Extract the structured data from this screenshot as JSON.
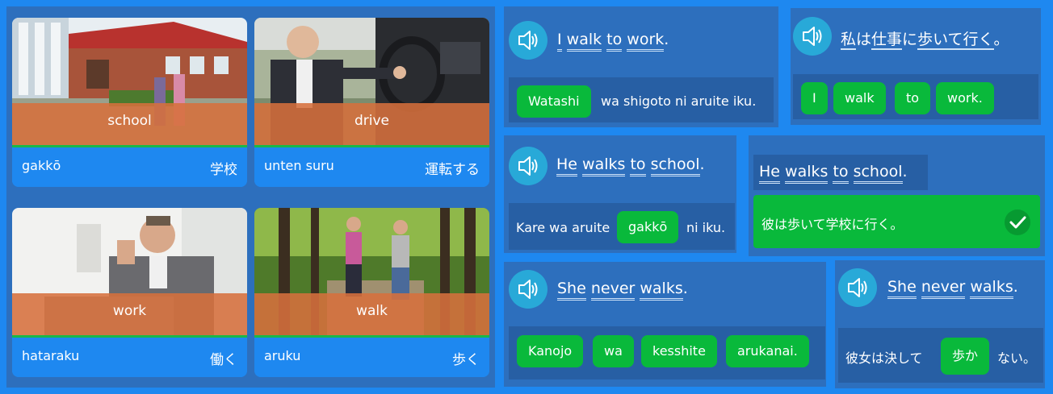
{
  "vocab": [
    {
      "en": "school",
      "romaji": "gakkō",
      "kana": "学校"
    },
    {
      "en": "drive",
      "romaji": "unten suru",
      "kana": "運転する"
    },
    {
      "en": "work",
      "romaji": "hataraku",
      "kana": "働く"
    },
    {
      "en": "walk",
      "romaji": "aruku",
      "kana": "歩く"
    }
  ],
  "p1": {
    "words": [
      "I",
      "walk",
      "to",
      "work"
    ],
    "punct": ".",
    "chip": "Watashi",
    "rest": "wa shigoto ni aruite iku."
  },
  "p2": {
    "jp": [
      "私",
      "は",
      "仕事",
      "に",
      "歩いて",
      "行く",
      "。"
    ],
    "chips": [
      "I",
      "walk",
      "to",
      "work."
    ]
  },
  "p3": {
    "words": [
      "He",
      "walks",
      "to",
      "school"
    ],
    "punct": ".",
    "before": "Kare wa aruite",
    "chip": "gakkō",
    "after": "ni iku."
  },
  "p4": {
    "words": [
      "He",
      "walks",
      "to",
      "school"
    ],
    "punct": ".",
    "answer": "彼は歩いて学校に行く。"
  },
  "p5": {
    "words": [
      "She",
      "never",
      "walks"
    ],
    "punct": ".",
    "chips": [
      "Kanojo",
      "wa",
      "kesshite",
      "arukanai."
    ]
  },
  "p6": {
    "words": [
      "She",
      "never",
      "walks"
    ],
    "punct": ".",
    "before": "彼女は決して",
    "chip": "歩か",
    "after": "ない。"
  },
  "colors": {
    "background": "#1e88f0",
    "panel": "#2d6fbd",
    "chip": "#09b93b",
    "band": "#d6703c",
    "speaker": "#28a9d8"
  }
}
